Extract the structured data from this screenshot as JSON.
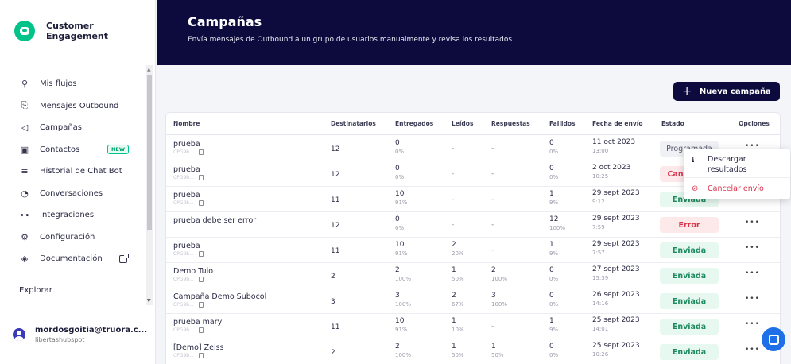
{
  "brand": {
    "name_line1": "Customer",
    "name_line2": "Engagement"
  },
  "sidebar": {
    "items": [
      {
        "label": "Mis flujos",
        "icon": "flow-tree-icon"
      },
      {
        "label": "Mensajes Outbound",
        "icon": "outbound-message-icon"
      },
      {
        "label": "Campañas",
        "icon": "megaphone-icon"
      },
      {
        "label": "Contactos",
        "icon": "contact-card-icon",
        "badge": "NEW"
      },
      {
        "label": "Historial de Chat Bot",
        "icon": "history-search-icon"
      },
      {
        "label": "Conversaciones",
        "icon": "conversation-icon"
      },
      {
        "label": "Integraciones",
        "icon": "integrations-icon"
      },
      {
        "label": "Configuración",
        "icon": "gear-icon"
      },
      {
        "label": "Documentación",
        "icon": "docs-icon"
      }
    ],
    "explore": "Explorar",
    "user": {
      "email": "mordosgoitia@truora.c...",
      "org": "libertashubspot"
    }
  },
  "header": {
    "title": "Campañas",
    "subtitle": "Envía mensajes de Outbound a un grupo de usuarios manualmente y revisa los resultados"
  },
  "new_campaign_button": "Nueva campaña",
  "table": {
    "headers": [
      "Nombre",
      "Destinatarios",
      "Entregados",
      "Leídos",
      "Respuestas",
      "Fallidos",
      "Fecha de envío",
      "Estado",
      "Opciones"
    ],
    "rows": [
      {
        "name": "prueba",
        "code": "CPG9b...",
        "recipients": "12",
        "delivered": "0",
        "delivered_pct": "0%",
        "read": "-",
        "read_pct": "",
        "replies": "-",
        "replies_pct": "",
        "failed": "0",
        "failed_pct": "0%",
        "date": "11 oct 2023",
        "time": "13:00",
        "status": "Programada",
        "status_type": "programada"
      },
      {
        "name": "prueba",
        "code": "CPG9b...",
        "recipients": "12",
        "delivered": "0",
        "delivered_pct": "0%",
        "read": "-",
        "read_pct": "",
        "replies": "-",
        "replies_pct": "",
        "failed": "0",
        "failed_pct": "0%",
        "date": "2 oct 2023",
        "time": "10:25",
        "status": "Cancelada",
        "status_type": "error"
      },
      {
        "name": "prueba",
        "code": "CPG9b...",
        "recipients": "11",
        "delivered": "10",
        "delivered_pct": "91%",
        "read": "-",
        "read_pct": "",
        "replies": "-",
        "replies_pct": "",
        "failed": "1",
        "failed_pct": "9%",
        "date": "29 sept 2023",
        "time": "9:12",
        "status": "Enviada",
        "status_type": "enviada"
      },
      {
        "name": "prueba debe ser error",
        "code": "",
        "recipients": "12",
        "delivered": "0",
        "delivered_pct": "0%",
        "read": "-",
        "read_pct": "",
        "replies": "-",
        "replies_pct": "",
        "failed": "12",
        "failed_pct": "100%",
        "date": "29 sept 2023",
        "time": "7:59",
        "status": "Error",
        "status_type": "error"
      },
      {
        "name": "prueba",
        "code": "CPG9b...",
        "recipients": "11",
        "delivered": "10",
        "delivered_pct": "91%",
        "read": "2",
        "read_pct": "20%",
        "replies": "-",
        "replies_pct": "",
        "failed": "1",
        "failed_pct": "9%",
        "date": "29 sept 2023",
        "time": "7:57",
        "status": "Enviada",
        "status_type": "enviada"
      },
      {
        "name": "Demo Tuio",
        "code": "CPG9b...",
        "recipients": "2",
        "delivered": "2",
        "delivered_pct": "100%",
        "read": "1",
        "read_pct": "50%",
        "replies": "2",
        "replies_pct": "100%",
        "failed": "0",
        "failed_pct": "0%",
        "date": "27 sept 2023",
        "time": "15:39",
        "status": "Enviada",
        "status_type": "enviada"
      },
      {
        "name": "Campaña Demo Subocol",
        "code": "CPG9b...",
        "recipients": "3",
        "delivered": "3",
        "delivered_pct": "100%",
        "read": "2",
        "read_pct": "67%",
        "replies": "3",
        "replies_pct": "100%",
        "failed": "0",
        "failed_pct": "0%",
        "date": "26 sept 2023",
        "time": "14:16",
        "status": "Enviada",
        "status_type": "enviada"
      },
      {
        "name": "prueba mary",
        "code": "CPG9b...",
        "recipients": "11",
        "delivered": "10",
        "delivered_pct": "91%",
        "read": "1",
        "read_pct": "10%",
        "replies": "-",
        "replies_pct": "",
        "failed": "1",
        "failed_pct": "9%",
        "date": "25 sept 2023",
        "time": "14:01",
        "status": "Enviada",
        "status_type": "enviada"
      },
      {
        "name": "[Demo] Zeiss",
        "code": "CPG9b...",
        "recipients": "2",
        "delivered": "2",
        "delivered_pct": "100%",
        "read": "1",
        "read_pct": "50%",
        "replies": "1",
        "replies_pct": "50%",
        "failed": "0",
        "failed_pct": "0%",
        "date": "25 sept 2023",
        "time": "10:26",
        "status": "Enviada",
        "status_type": "enviada"
      }
    ]
  },
  "dropdown": {
    "download": "Descargar resultados",
    "cancel": "Cancelar envío"
  },
  "options_glyph": "•••",
  "colors": {
    "header_bg": "#0d0b3d",
    "accent_green": "#00c389",
    "error_red": "#d9334a",
    "chat_blue": "#1e6fe8"
  }
}
